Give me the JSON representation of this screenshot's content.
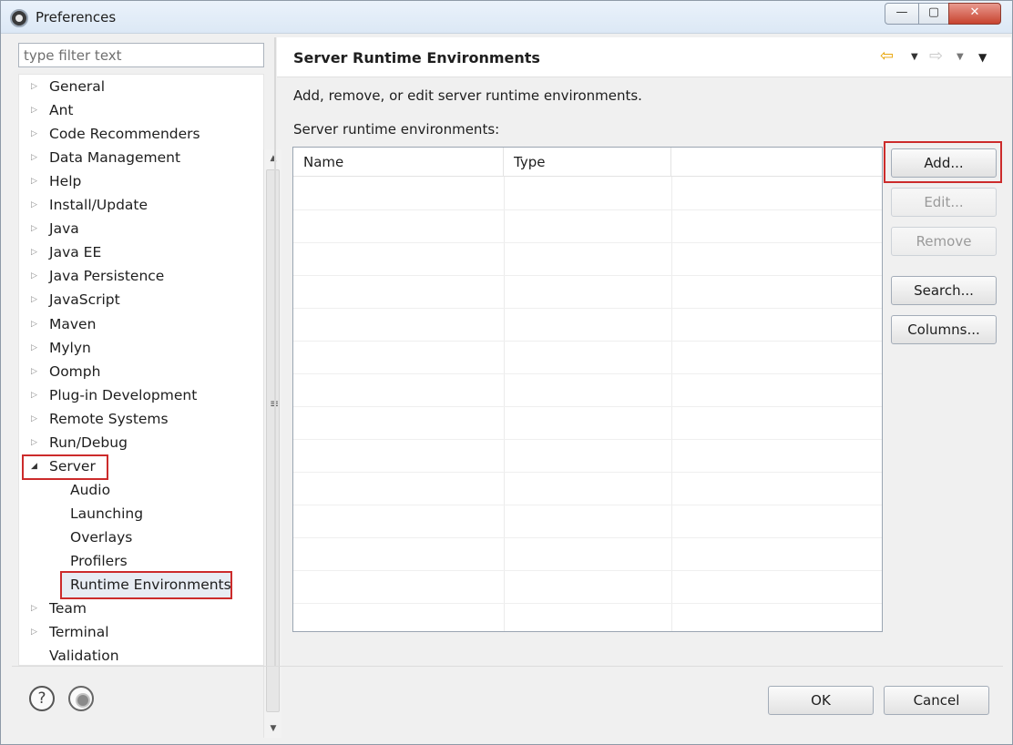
{
  "window": {
    "title": "Preferences",
    "minimize": "—",
    "maximize": "▢",
    "close": "✕"
  },
  "filter": {
    "placeholder": "type filter text"
  },
  "tree": {
    "items": [
      {
        "label": "General",
        "expandable": true
      },
      {
        "label": "Ant",
        "expandable": true
      },
      {
        "label": "Code Recommenders",
        "expandable": true
      },
      {
        "label": "Data Management",
        "expandable": true
      },
      {
        "label": "Help",
        "expandable": true
      },
      {
        "label": "Install/Update",
        "expandable": true
      },
      {
        "label": "Java",
        "expandable": true
      },
      {
        "label": "Java EE",
        "expandable": true
      },
      {
        "label": "Java Persistence",
        "expandable": true
      },
      {
        "label": "JavaScript",
        "expandable": true
      },
      {
        "label": "Maven",
        "expandable": true
      },
      {
        "label": "Mylyn",
        "expandable": true
      },
      {
        "label": "Oomph",
        "expandable": true
      },
      {
        "label": "Plug-in Development",
        "expandable": true
      },
      {
        "label": "Remote Systems",
        "expandable": true
      },
      {
        "label": "Run/Debug",
        "expandable": true
      },
      {
        "label": "Server",
        "expandable": true,
        "expanded": true
      },
      {
        "label": "Audio",
        "child": true
      },
      {
        "label": "Launching",
        "child": true
      },
      {
        "label": "Overlays",
        "child": true
      },
      {
        "label": "Profilers",
        "child": true
      },
      {
        "label": "Runtime Environments",
        "child": true,
        "selected": true
      },
      {
        "label": "Team",
        "expandable": true
      },
      {
        "label": "Terminal",
        "expandable": true
      },
      {
        "label": "Validation",
        "expandable": false
      }
    ]
  },
  "page": {
    "title": "Server Runtime Environments",
    "description": "Add, remove, or edit server runtime environments.",
    "list_label": "Server runtime environments:",
    "columns": [
      "Name",
      "Type",
      ""
    ]
  },
  "buttons": {
    "add": "Add...",
    "edit": "Edit...",
    "remove": "Remove",
    "search": "Search...",
    "columns": "Columns...",
    "ok": "OK",
    "cancel": "Cancel"
  },
  "icons": {
    "help": "?",
    "highlight_color": "#cc2b2b"
  }
}
